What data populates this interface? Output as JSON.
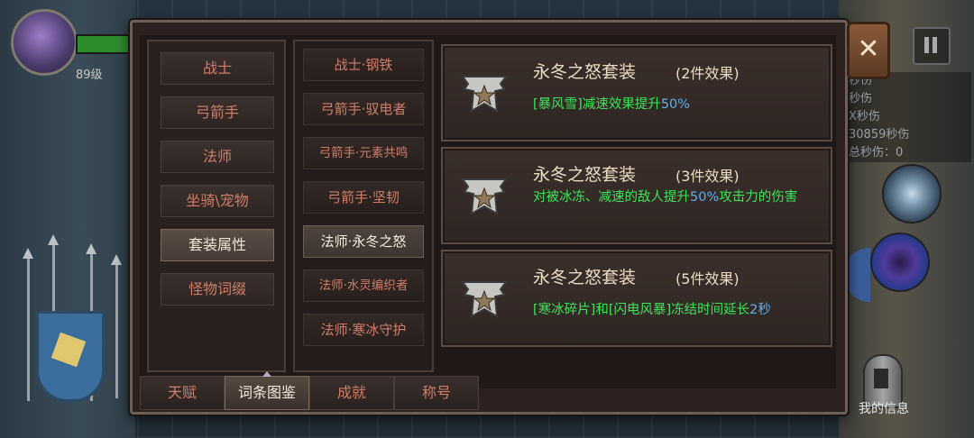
{
  "hud": {
    "level_text": "89级",
    "dps_lines": [
      "秒伤",
      "秒伤",
      "X秒伤",
      "30859秒伤",
      "总秒伤：0"
    ],
    "info_label": "我的信息"
  },
  "panel": {
    "close_label": "✕",
    "categories": [
      {
        "label": "战士",
        "active": false
      },
      {
        "label": "弓箭手",
        "active": false
      },
      {
        "label": "法师",
        "active": false
      },
      {
        "label": "坐骑\\宠物",
        "active": false
      },
      {
        "label": "套装属性",
        "active": true
      },
      {
        "label": "怪物词缀",
        "active": false
      }
    ],
    "sets": [
      {
        "label": "战士·钢铁",
        "active": false
      },
      {
        "label": "弓箭手·驭电者",
        "active": false
      },
      {
        "label": "弓箭手·元素共鸣",
        "active": false
      },
      {
        "label": "弓箭手·坚韧",
        "active": false
      },
      {
        "label": "法师·永冬之怒",
        "active": true
      },
      {
        "label": "法师·水灵编织者",
        "active": false
      },
      {
        "label": "法师·寒冰守护",
        "active": false
      }
    ],
    "effects": [
      {
        "title": "永冬之怒套装",
        "count": "(2件效果)",
        "desc_parts": [
          "[暴风雪]减速效果提升",
          "50%",
          ""
        ]
      },
      {
        "title": "永冬之怒套装",
        "count": "(3件效果)",
        "desc_parts": [
          "对被冰冻、减速的敌人提升",
          "50%",
          "攻击力的伤害"
        ]
      },
      {
        "title": "永冬之怒套装",
        "count": "(5件效果)",
        "desc_parts": [
          "[寒冰碎片]和[闪电风暴]冻结时间延长",
          "2秒",
          ""
        ]
      }
    ],
    "tabs": [
      {
        "label": "天赋",
        "active": false
      },
      {
        "label": "词条图鉴",
        "active": true
      },
      {
        "label": "成就",
        "active": false
      },
      {
        "label": "称号",
        "active": false
      }
    ]
  }
}
